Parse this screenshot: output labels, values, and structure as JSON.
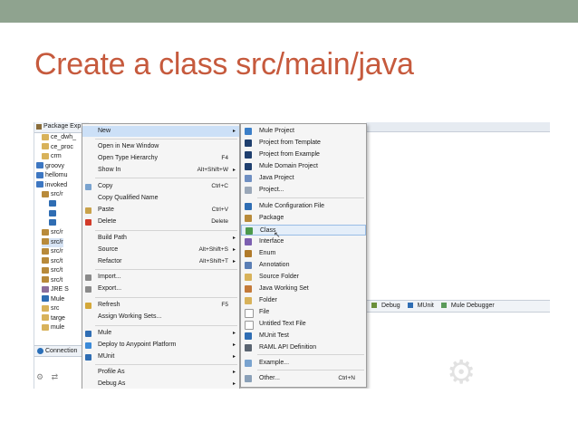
{
  "slide": {
    "title": "Create a class src/main/java"
  },
  "explorer": {
    "header": "Package Exp",
    "items": [
      {
        "label": "ce_dwh_",
        "icon": "folder-icon"
      },
      {
        "label": "ce_proc",
        "icon": "folder-icon"
      },
      {
        "label": "crm",
        "icon": "folder-icon"
      },
      {
        "label": "groovy",
        "icon": "project-icon"
      },
      {
        "label": "hellomu",
        "icon": "project-icon"
      },
      {
        "label": "invoked",
        "icon": "project-icon"
      },
      {
        "label": "src/r",
        "icon": "package-icon"
      },
      {
        "label": "",
        "icon": "class-icon"
      },
      {
        "label": "",
        "icon": "class-icon"
      },
      {
        "label": "",
        "icon": "class-icon"
      },
      {
        "label": "src/r",
        "icon": "package-icon"
      },
      {
        "label": "src/r",
        "icon": "package-icon"
      },
      {
        "label": "src/r",
        "icon": "package-icon"
      },
      {
        "label": "src/t",
        "icon": "package-icon"
      },
      {
        "label": "src/t",
        "icon": "package-icon"
      },
      {
        "label": "src/t",
        "icon": "package-icon"
      },
      {
        "label": "JRE S",
        "icon": "jre-icon"
      },
      {
        "label": "Mule",
        "icon": "mule-icon"
      },
      {
        "label": "src",
        "icon": "folder-icon"
      },
      {
        "label": "targe",
        "icon": "folder-icon"
      },
      {
        "label": "mule",
        "icon": "folder-icon"
      }
    ],
    "connections_tab": "Connection"
  },
  "context_menu": {
    "items": [
      {
        "label": "New",
        "shortcut": "",
        "submenu": true,
        "highlight": true,
        "icon": ""
      },
      {
        "label": "Open in New Window",
        "shortcut": "",
        "submenu": false,
        "icon": ""
      },
      {
        "label": "Open Type Hierarchy",
        "shortcut": "F4",
        "submenu": false,
        "icon": ""
      },
      {
        "label": "Show In",
        "shortcut": "Alt+Shift+W",
        "submenu": true,
        "icon": ""
      },
      {
        "label": "Copy",
        "shortcut": "Ctrl+C",
        "submenu": false,
        "icon": "copy-icon"
      },
      {
        "label": "Copy Qualified Name",
        "shortcut": "",
        "submenu": false,
        "icon": ""
      },
      {
        "label": "Paste",
        "shortcut": "Ctrl+V",
        "submenu": false,
        "icon": "paste-icon"
      },
      {
        "label": "Delete",
        "shortcut": "Delete",
        "submenu": false,
        "icon": "delete-icon"
      },
      {
        "label": "Build Path",
        "shortcut": "",
        "submenu": true,
        "icon": ""
      },
      {
        "label": "Source",
        "shortcut": "Alt+Shift+S",
        "submenu": true,
        "icon": ""
      },
      {
        "label": "Refactor",
        "shortcut": "Alt+Shift+T",
        "submenu": true,
        "icon": ""
      },
      {
        "label": "Import...",
        "shortcut": "",
        "submenu": false,
        "icon": "import-icon"
      },
      {
        "label": "Export...",
        "shortcut": "",
        "submenu": false,
        "icon": "export-icon"
      },
      {
        "label": "Refresh",
        "shortcut": "F5",
        "submenu": false,
        "icon": "refresh-icon"
      },
      {
        "label": "Assign Working Sets...",
        "shortcut": "",
        "submenu": false,
        "icon": ""
      },
      {
        "label": "Mule",
        "shortcut": "",
        "submenu": true,
        "icon": "mule-icon"
      },
      {
        "label": "Deploy to Anypoint Platform",
        "shortcut": "",
        "submenu": true,
        "icon": "deploy-icon"
      },
      {
        "label": "MUnit",
        "shortcut": "",
        "submenu": true,
        "icon": "munit-icon"
      },
      {
        "label": "Profile As",
        "shortcut": "",
        "submenu": true,
        "icon": ""
      },
      {
        "label": "Debug As",
        "shortcut": "",
        "submenu": true,
        "icon": ""
      }
    ]
  },
  "new_submenu": {
    "items": [
      {
        "label": "Mule Project",
        "shortcut": "",
        "icon": "mule-project-icon"
      },
      {
        "label": "Project from Template",
        "shortcut": "",
        "icon": "template-icon"
      },
      {
        "label": "Project from Example",
        "shortcut": "",
        "icon": "example-icon"
      },
      {
        "label": "Mule Domain Project",
        "shortcut": "",
        "icon": "domain-icon"
      },
      {
        "label": "Java Project",
        "shortcut": "",
        "icon": "java-project-icon"
      },
      {
        "label": "Project...",
        "shortcut": "",
        "icon": "project-icon"
      },
      {
        "label": "Mule Configuration File",
        "shortcut": "",
        "icon": "mule-config-icon"
      },
      {
        "label": "Package",
        "shortcut": "",
        "icon": "package-icon"
      },
      {
        "label": "Class",
        "shortcut": "",
        "icon": "class-icon",
        "highlight": true
      },
      {
        "label": "Interface",
        "shortcut": "",
        "icon": "interface-icon"
      },
      {
        "label": "Enum",
        "shortcut": "",
        "icon": "enum-icon"
      },
      {
        "label": "Annotation",
        "shortcut": "",
        "icon": "annotation-icon"
      },
      {
        "label": "Source Folder",
        "shortcut": "",
        "icon": "source-folder-icon"
      },
      {
        "label": "Java Working Set",
        "shortcut": "",
        "icon": "working-set-icon"
      },
      {
        "label": "Folder",
        "shortcut": "",
        "icon": "folder-icon"
      },
      {
        "label": "File",
        "shortcut": "",
        "icon": "file-icon"
      },
      {
        "label": "Untitled Text File",
        "shortcut": "",
        "icon": "text-file-icon"
      },
      {
        "label": "MUnit Test",
        "shortcut": "",
        "icon": "munit-test-icon"
      },
      {
        "label": "RAML API Definition",
        "shortcut": "",
        "icon": "raml-icon"
      },
      {
        "label": "Example...",
        "shortcut": "",
        "icon": "example-wizard-icon"
      },
      {
        "label": "Other...",
        "shortcut": "Ctrl+N",
        "icon": "other-icon"
      }
    ]
  },
  "bottom_tabs": [
    {
      "label": "Debug",
      "icon": "debug-icon"
    },
    {
      "label": "MUnit",
      "icon": "munit-icon"
    },
    {
      "label": "Mule Debugger",
      "icon": "mule-debugger-icon"
    }
  ],
  "colors": {
    "topbar": "#8fa38f",
    "title": "#c65a3d",
    "menu_highlight": "#cce0f7"
  }
}
